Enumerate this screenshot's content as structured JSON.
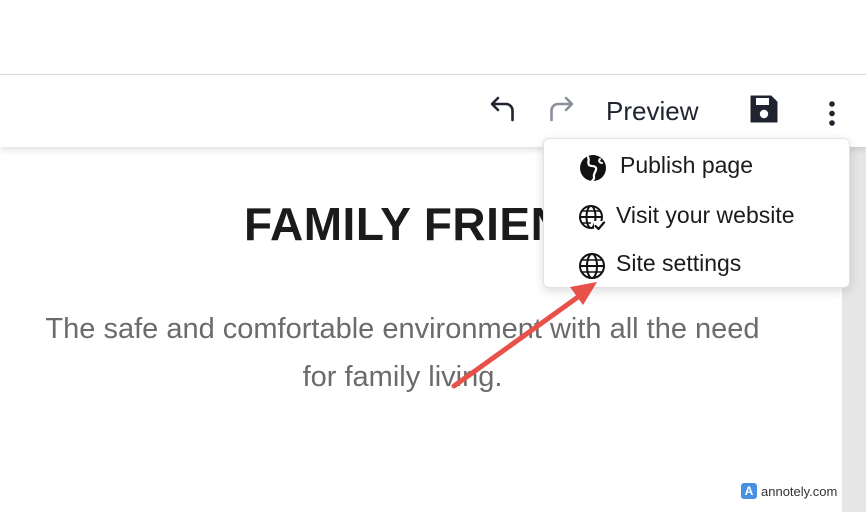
{
  "toolbar": {
    "undo_icon": "undo-arrow-icon",
    "redo_icon": "redo-arrow-icon",
    "preview_label": "Preview",
    "save_icon": "floppy-disk-icon",
    "more_icon": "vertical-ellipsis-icon"
  },
  "page": {
    "title": "FAMILY FRIEND",
    "body": "The safe and comfortable environment with all the need for family living."
  },
  "menu": {
    "items": [
      {
        "label": "Publish page",
        "icon": "filled-globe-icon"
      },
      {
        "label": "Visit your website",
        "icon": "globe-check-icon"
      },
      {
        "label": "Site settings",
        "icon": "globe-icon"
      }
    ]
  },
  "annotation": {
    "arrow_color": "#e8504a",
    "watermark": "annotely.com",
    "watermark_logo": "A"
  },
  "colors": {
    "text_dark": "#1b1b1b",
    "redo_disabled": "#8a8f99",
    "body_text": "#6b6b6b"
  }
}
